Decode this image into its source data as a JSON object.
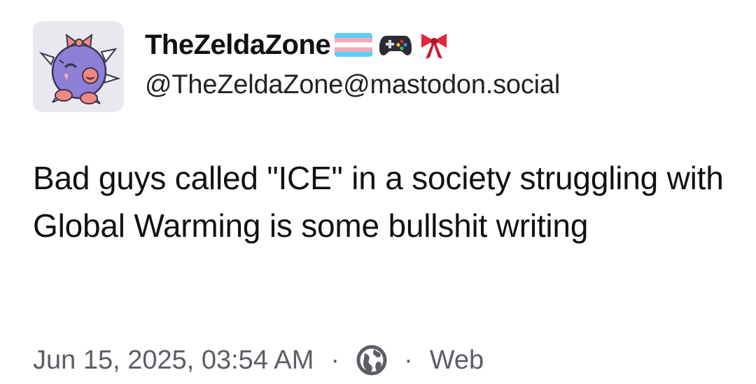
{
  "post": {
    "display_name": "TheZeldaZone",
    "name_emojis": [
      "transgender-flag-icon",
      "game-controller-icon",
      "ribbon-bow-icon"
    ],
    "handle": "@TheZeldaZone@mastodon.social",
    "content": "Bad guys called \"ICE\" in a society struggling with Global Warming is some bullshit writing",
    "timestamp": "Jun 15, 2025, 03:54 AM",
    "separator": "·",
    "visibility_icon": "globe-icon",
    "source": "Web"
  },
  "colors": {
    "avatar_background": "#e9e8ef",
    "avatar_character": "#8d7fd6",
    "avatar_accent": "#f08a80",
    "text_primary": "#111111",
    "text_secondary": "#5d5d66",
    "flag_blue": "#5bcefa",
    "flag_pink": "#f5a9b8",
    "bow_red": "#e0263b"
  }
}
